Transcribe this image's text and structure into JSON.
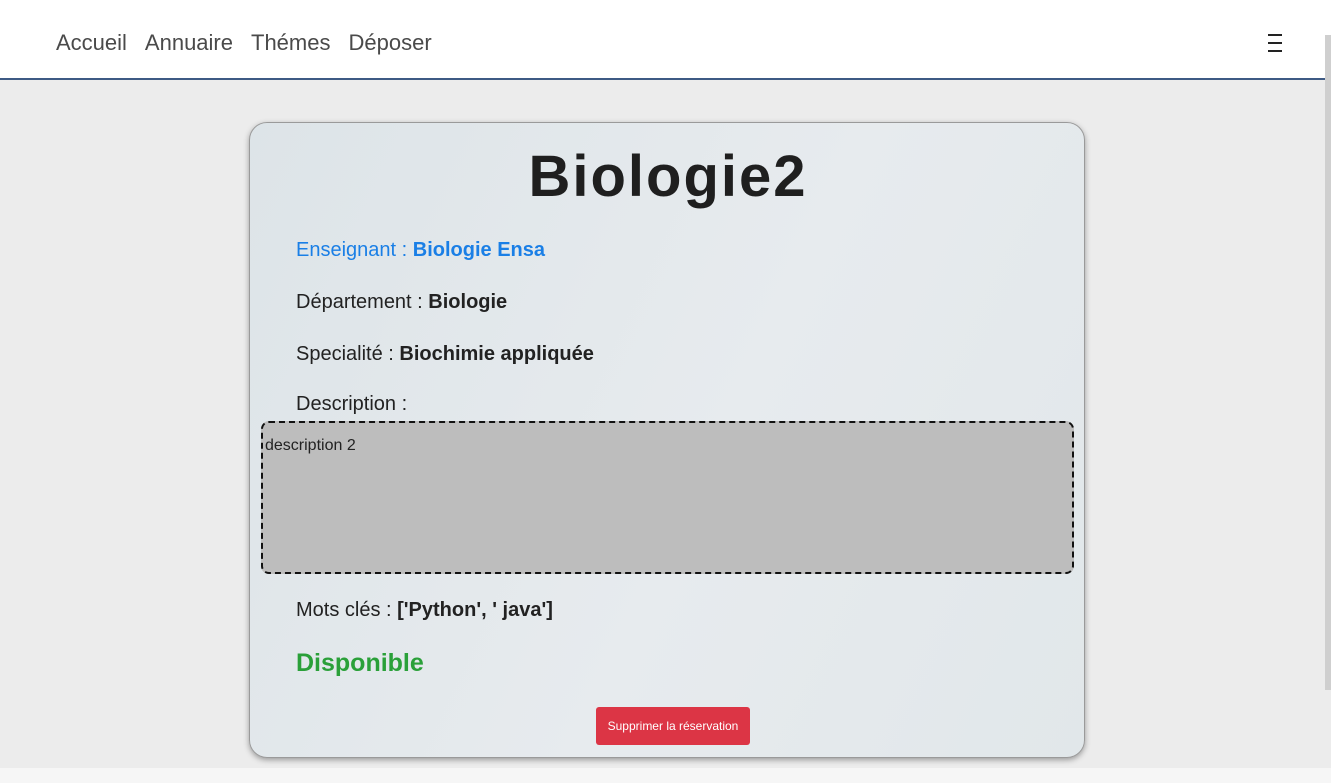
{
  "nav": {
    "links": [
      "Accueil",
      "Annuaire",
      "Thémes",
      "Déposer"
    ],
    "menu_icon": "hamburger-icon"
  },
  "subject": {
    "title": "Biologie2",
    "teacher_label": "Enseignant : ",
    "teacher_value": "Biologie Ensa",
    "department_label": "Département : ",
    "department_value": "Biologie",
    "speciality_label": "Specialité : ",
    "speciality_value": "Biochimie appliquée",
    "description_label": "Description :",
    "description_value": "description 2",
    "keywords_label": "Mots clés : ",
    "keywords_value": "['Python', ' java']",
    "status": "Disponible",
    "delete_button": "Supprimer la réservation"
  },
  "colors": {
    "link_blue": "#1a7fe6",
    "status_green": "#2aa039",
    "danger": "#dc3545",
    "nav_border": "#3e5a84"
  }
}
